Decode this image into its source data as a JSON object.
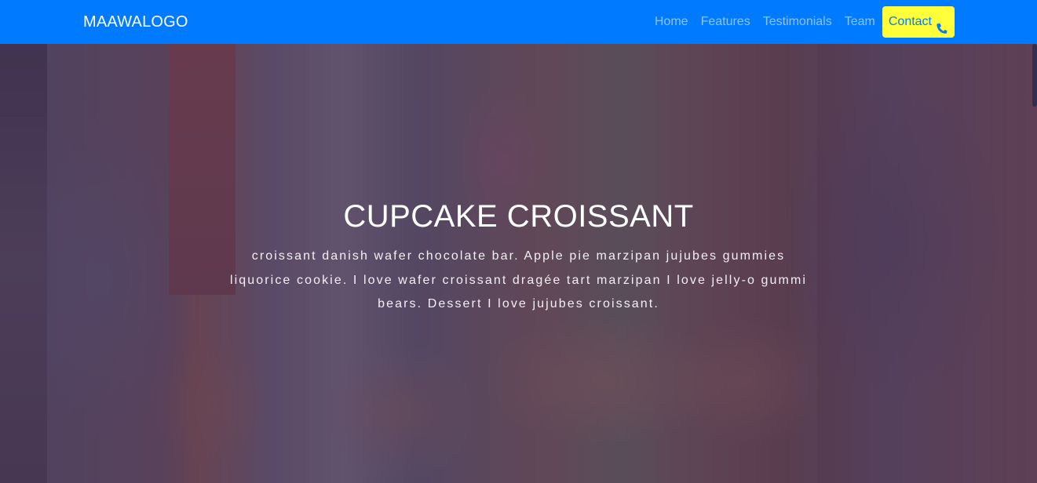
{
  "navbar": {
    "brand": "MAAWALOGO",
    "links": [
      "Home",
      "Features",
      "Testimonials",
      "Team"
    ],
    "cta_label": "Contact",
    "cta_icon": "phone-icon",
    "background_color": "#007bff",
    "cta_background_color": "#ffff3a"
  },
  "hero": {
    "title": "CUPCAKE CROISSANT",
    "text": "croissant danish wafer chocolate bar. Apple pie marzipan jujubes gummies liquorice cookie. I love wafer croissant dragée tart marzipan I love jelly-o gummi bears. Dessert I love jujubes croissant.",
    "background_image": "photo-children-in-alley",
    "overlay_color": "#3a1e3a"
  }
}
